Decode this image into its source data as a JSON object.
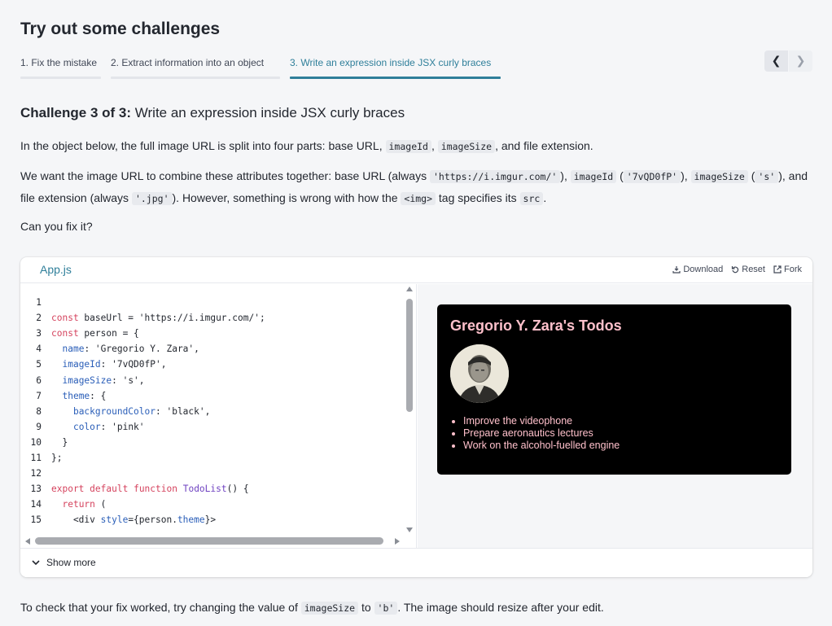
{
  "page_title": "Try out some challenges",
  "tabs": [
    {
      "label": "1. Fix the mistake"
    },
    {
      "label": "2. Extract information into an object"
    },
    {
      "label": "3. Write an expression inside JSX curly braces"
    }
  ],
  "nav": {
    "prev_icon": "chevron-left-icon",
    "next_icon": "chevron-right-icon"
  },
  "challenge": {
    "counter": "Challenge 3 of 3:",
    "title": "Write an expression inside JSX curly braces"
  },
  "para1": {
    "a": "In the object below, the full image URL is split into four parts: base URL,",
    "code1": "imageId",
    "code2": "imageSize",
    "b": ", and file extension."
  },
  "para2": {
    "a": "We want the image URL to combine these attributes together: base URL (always",
    "c1": "'https://i.imgur.com/'",
    "b": "),",
    "c2": "imageId",
    "c3": "'7vQD0fP'",
    "c4": "imageSize",
    "c5": "'s'",
    "d": "and file extension (always",
    "c6": "'.jpg'",
    "e": "). However, something is wrong with how the",
    "c7": "<img>",
    "f": "tag specifies its",
    "c8": "src"
  },
  "para3": "Can you fix it?",
  "sandbox": {
    "file_tab": "App.js",
    "actions": {
      "download": "Download",
      "reset": "Reset",
      "fork": "Fork"
    },
    "code_lines": [
      {
        "n": "1",
        "t": ""
      },
      {
        "n": "2",
        "t": "const baseUrl = 'https://i.imgur.com/';"
      },
      {
        "n": "3",
        "t": "const person = {"
      },
      {
        "n": "4",
        "t": "  name: 'Gregorio Y. Zara',"
      },
      {
        "n": "5",
        "t": "  imageId: '7vQD0fP',"
      },
      {
        "n": "6",
        "t": "  imageSize: 's',"
      },
      {
        "n": "7",
        "t": "  theme: {"
      },
      {
        "n": "8",
        "t": "    backgroundColor: 'black',"
      },
      {
        "n": "9",
        "t": "    color: 'pink'"
      },
      {
        "n": "10",
        "t": "  }"
      },
      {
        "n": "11",
        "t": "};"
      },
      {
        "n": "12",
        "t": ""
      },
      {
        "n": "13",
        "t": "export default function TodoList() {"
      },
      {
        "n": "14",
        "t": "  return ("
      },
      {
        "n": "15",
        "t": "    <div style={person.theme}>"
      }
    ],
    "preview": {
      "heading": "Gregorio Y. Zara's Todos",
      "todos": [
        "Improve the videophone",
        "Prepare aeronautics lectures",
        "Work on the alcohol-fuelled engine"
      ]
    },
    "show_more": "Show more"
  },
  "footer": {
    "a": "To check that your fix worked, try changing the value of",
    "c1": "imageSize",
    "b": "to",
    "c2": "'b'",
    "c": ". The image should resize after your edit."
  },
  "colors": {
    "accent": "#2f7f9a",
    "preview_text": "#ffc0cb",
    "preview_bg": "#000000"
  }
}
